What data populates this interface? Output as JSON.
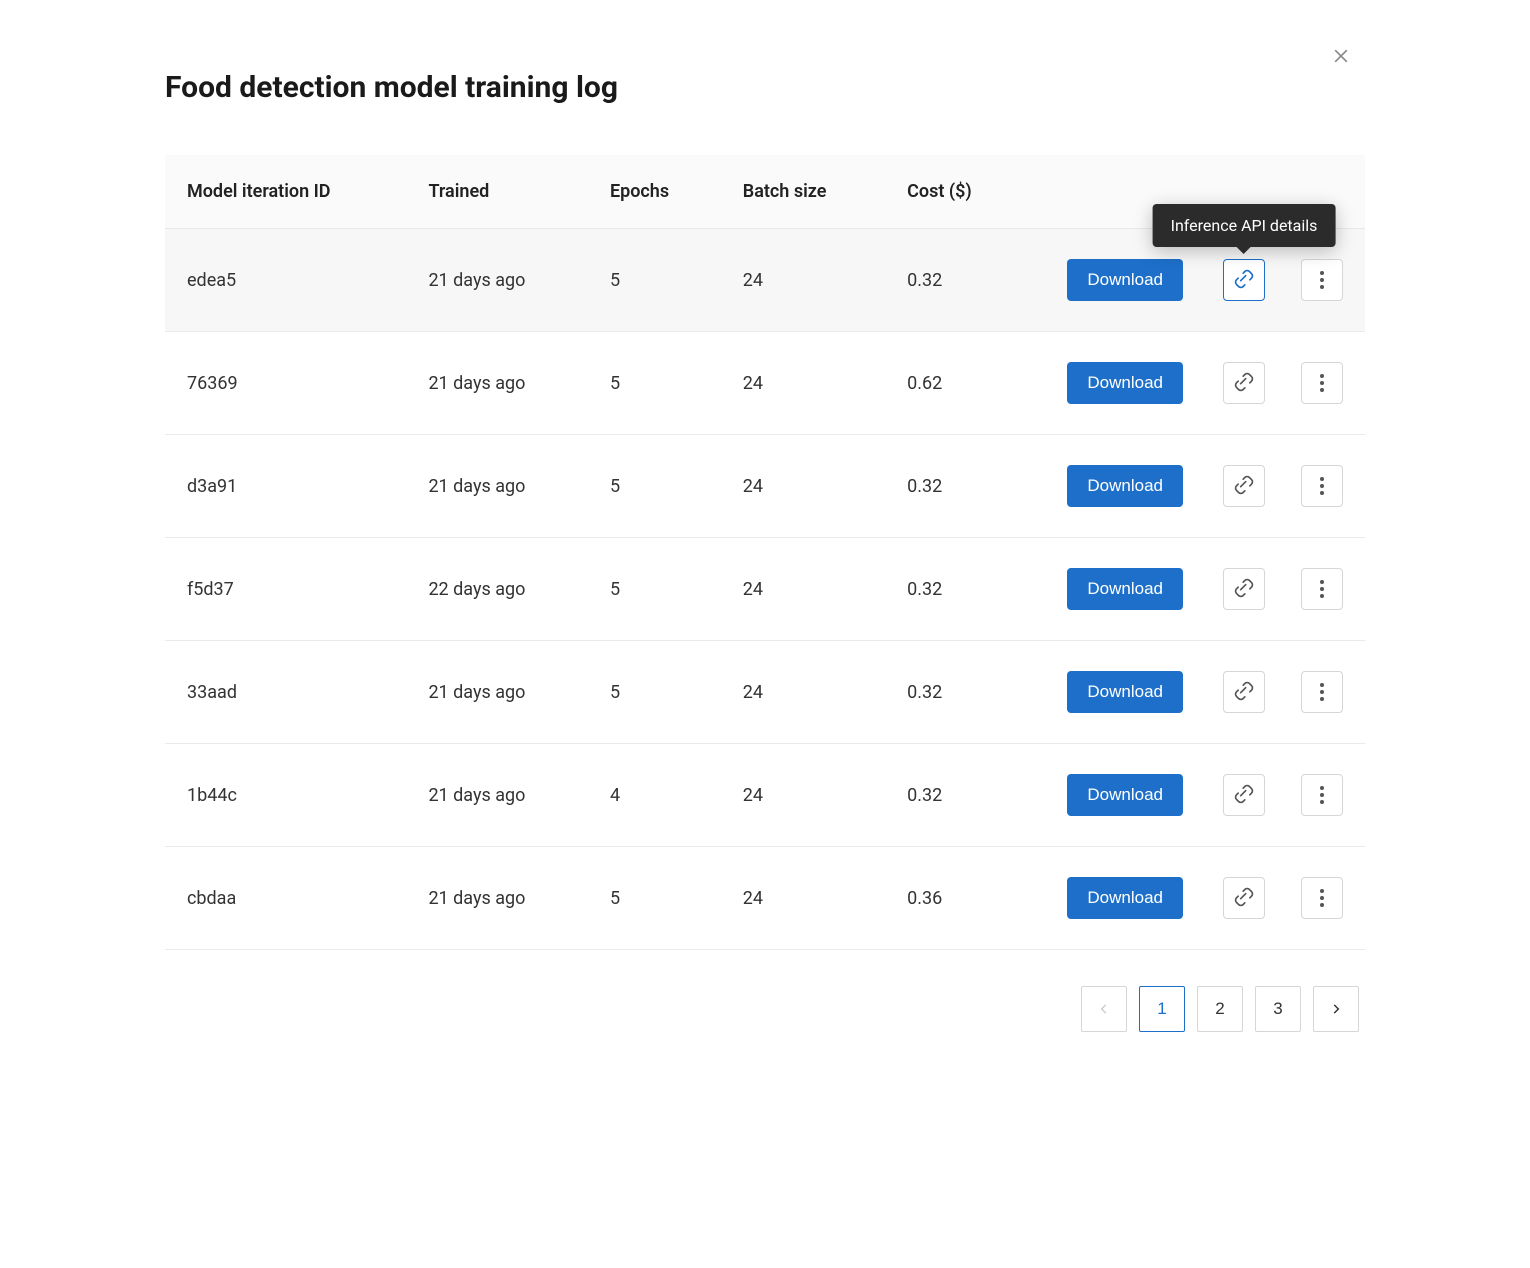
{
  "title": "Food detection model training log",
  "tooltip": "Inference API details",
  "download_label": "Download",
  "columns": {
    "id": "Model iteration ID",
    "trained": "Trained",
    "epochs": "Epochs",
    "batch": "Batch size",
    "cost": "Cost ($)"
  },
  "rows": [
    {
      "id": "edea5",
      "trained": "21 days ago",
      "epochs": "5",
      "batch": "24",
      "cost": "0.32",
      "selected": true
    },
    {
      "id": "76369",
      "trained": "21 days ago",
      "epochs": "5",
      "batch": "24",
      "cost": "0.62",
      "selected": false
    },
    {
      "id": "d3a91",
      "trained": "21 days ago",
      "epochs": "5",
      "batch": "24",
      "cost": "0.32",
      "selected": false
    },
    {
      "id": "f5d37",
      "trained": "22 days ago",
      "epochs": "5",
      "batch": "24",
      "cost": "0.32",
      "selected": false
    },
    {
      "id": "33aad",
      "trained": "21 days ago",
      "epochs": "5",
      "batch": "24",
      "cost": "0.32",
      "selected": false
    },
    {
      "id": "1b44c",
      "trained": "21 days ago",
      "epochs": "4",
      "batch": "24",
      "cost": "0.32",
      "selected": false
    },
    {
      "id": "cbdaa",
      "trained": "21 days ago",
      "epochs": "5",
      "batch": "24",
      "cost": "0.36",
      "selected": false
    }
  ],
  "pagination": {
    "pages": [
      "1",
      "2",
      "3"
    ],
    "current": "1",
    "prev_disabled": true
  }
}
